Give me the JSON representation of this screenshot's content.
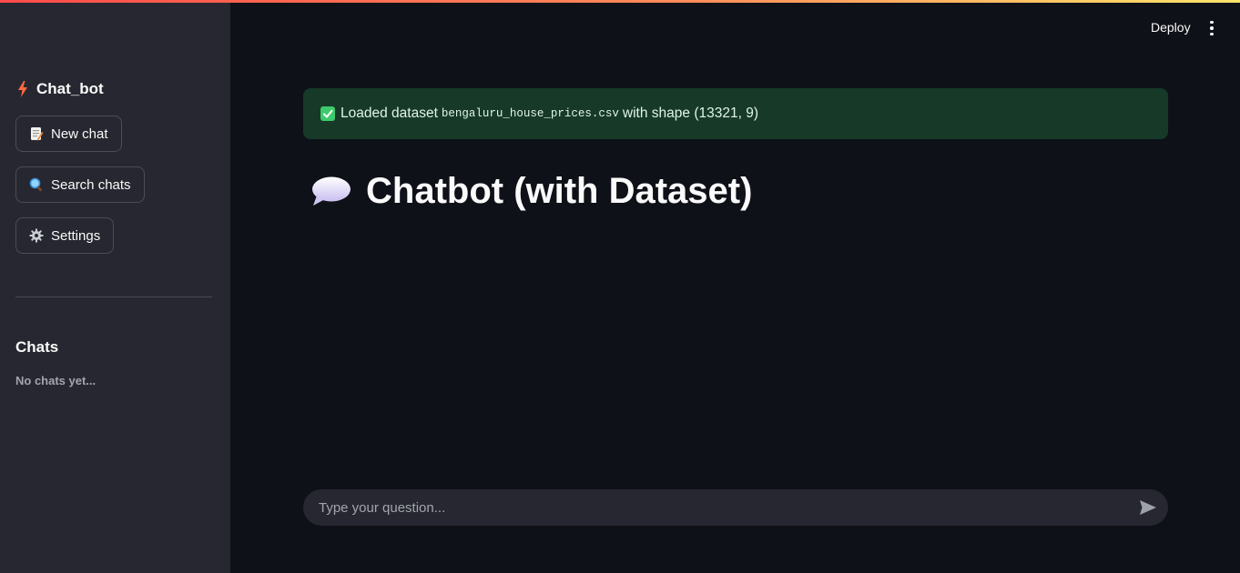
{
  "sidebar": {
    "brand": "Chat_bot",
    "buttons": {
      "new_chat": "New chat",
      "search_chats": "Search chats",
      "settings": "Settings"
    },
    "chats_heading": "Chats",
    "chats_empty": "No chats yet..."
  },
  "header": {
    "deploy_label": "Deploy",
    "menu_icon": "kebab-menu-icon"
  },
  "alert": {
    "prefix": "Loaded dataset",
    "filename": "bengaluru_house_prices.csv",
    "suffix": "with shape (13321, 9)",
    "icon": "check-icon"
  },
  "main": {
    "title": "Chatbot (with Dataset)",
    "title_icon": "speech-bubble-icon"
  },
  "chat_input": {
    "placeholder": "Type your question...",
    "send_icon": "send-icon"
  },
  "colors": {
    "app_background": "#0e1117",
    "sidebar_background": "#262730",
    "success_background": "#173928",
    "success_check": "#3ec96c",
    "accent_bolt": "#ff6b3d"
  }
}
